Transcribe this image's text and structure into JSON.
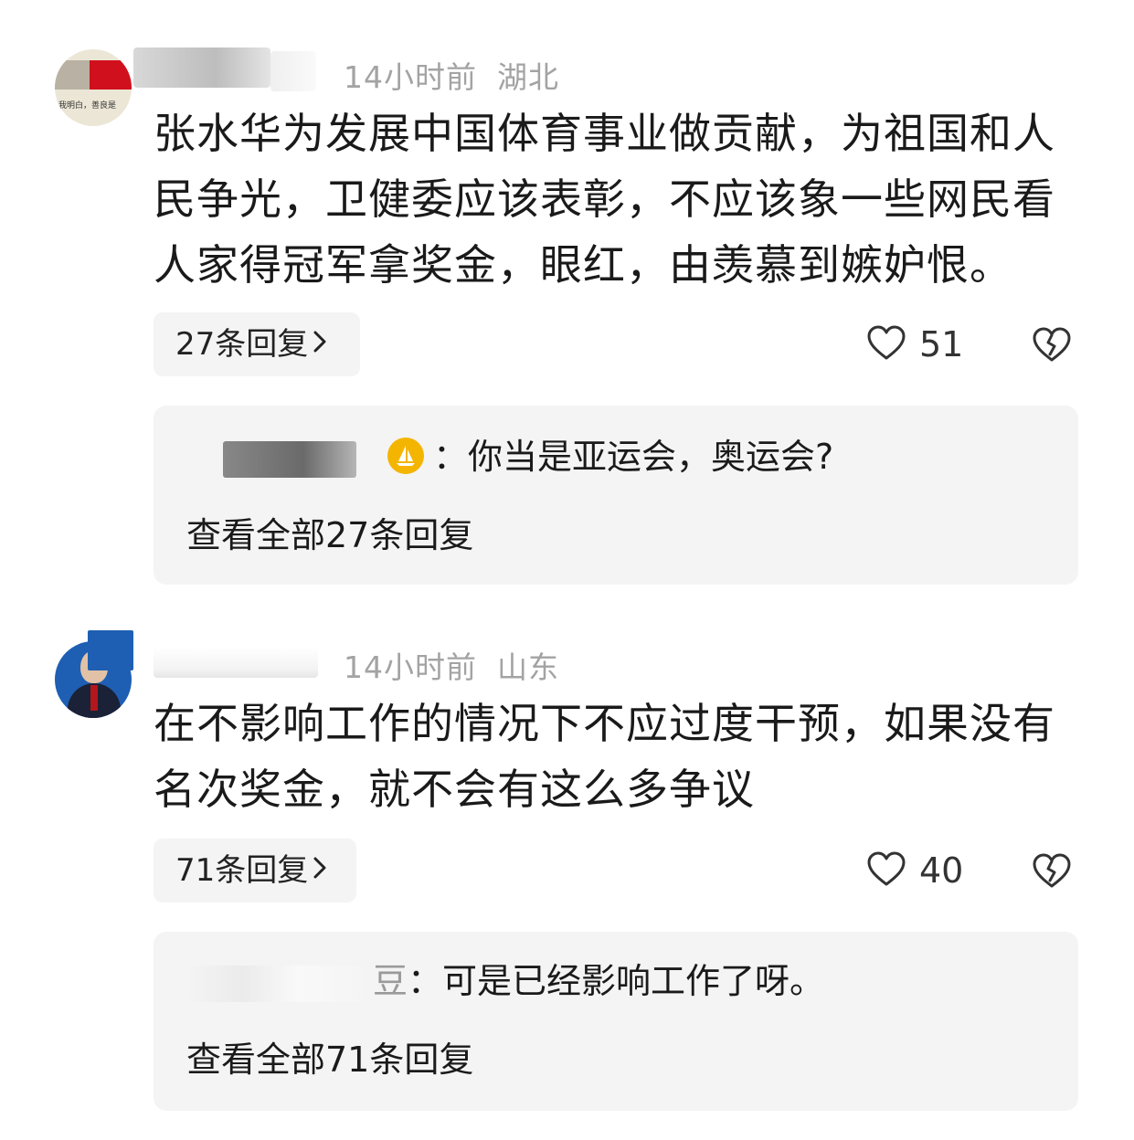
{
  "comments": [
    {
      "time": "14小时前",
      "region": "湖北",
      "name_tail": "",
      "content": "张水华为发展中国体育事业做贡献，为祖国和人民争光，卫健委应该表彰，不应该象一些网民看人家得冠军拿奖金，眼红，由羡慕到嫉妒恨。",
      "reply_count_label": "27条回复",
      "likes": "51",
      "preview_reply": {
        "author_tail": "",
        "text": "：你当是亚运会，奥运会?"
      },
      "view_all_label": "查看全部27条回复",
      "avatar_text": "我明白，善良是"
    },
    {
      "time": "14小时前",
      "region": "山东",
      "content": "在不影响工作的情况下不应过度干预，如果没有名次奖金，就不会有这么多争议",
      "reply_count_label": "71条回复",
      "likes": "40",
      "preview_reply": {
        "author_tail": "豆",
        "text": "：可是已经影响工作了呀。"
      },
      "view_all_label": "查看全部71条回复"
    }
  ],
  "icons": {
    "like": "heart-outline-icon",
    "dislike": "broken-heart-icon",
    "chevron": "chevron-right-icon",
    "badge": "sail-badge-icon"
  },
  "colors": {
    "meta": "#a3a3a3",
    "pill_bg": "#f4f4f4",
    "badge": "#f3b500"
  }
}
